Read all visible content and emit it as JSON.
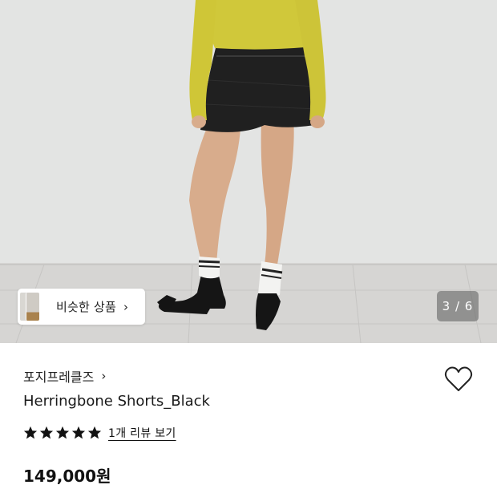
{
  "product_image": {
    "alt": "Herringbone Shorts_Black",
    "colors": {
      "wall": "#e3e4e3",
      "floor": "#d7d6d4",
      "top": "#d0c83a",
      "shorts": "#202020",
      "skin": "#d8ac8c",
      "shoe": "#151515"
    }
  },
  "similar_products": {
    "label": "비슷한 상품",
    "chevron": "chevron-right-icon"
  },
  "pagination": {
    "current": 3,
    "total": 6,
    "text": "3 / 6"
  },
  "brand": {
    "name": "포지프레클즈",
    "chevron": "chevron-right-icon"
  },
  "wishlist": {
    "icon": "heart-outline-icon"
  },
  "product": {
    "title": "Herringbone Shorts_Black",
    "price": "149,000원"
  },
  "rating": {
    "stars": 5,
    "max": 5,
    "review_link": "1개 리뷰 보기",
    "star_color": "#111111"
  }
}
